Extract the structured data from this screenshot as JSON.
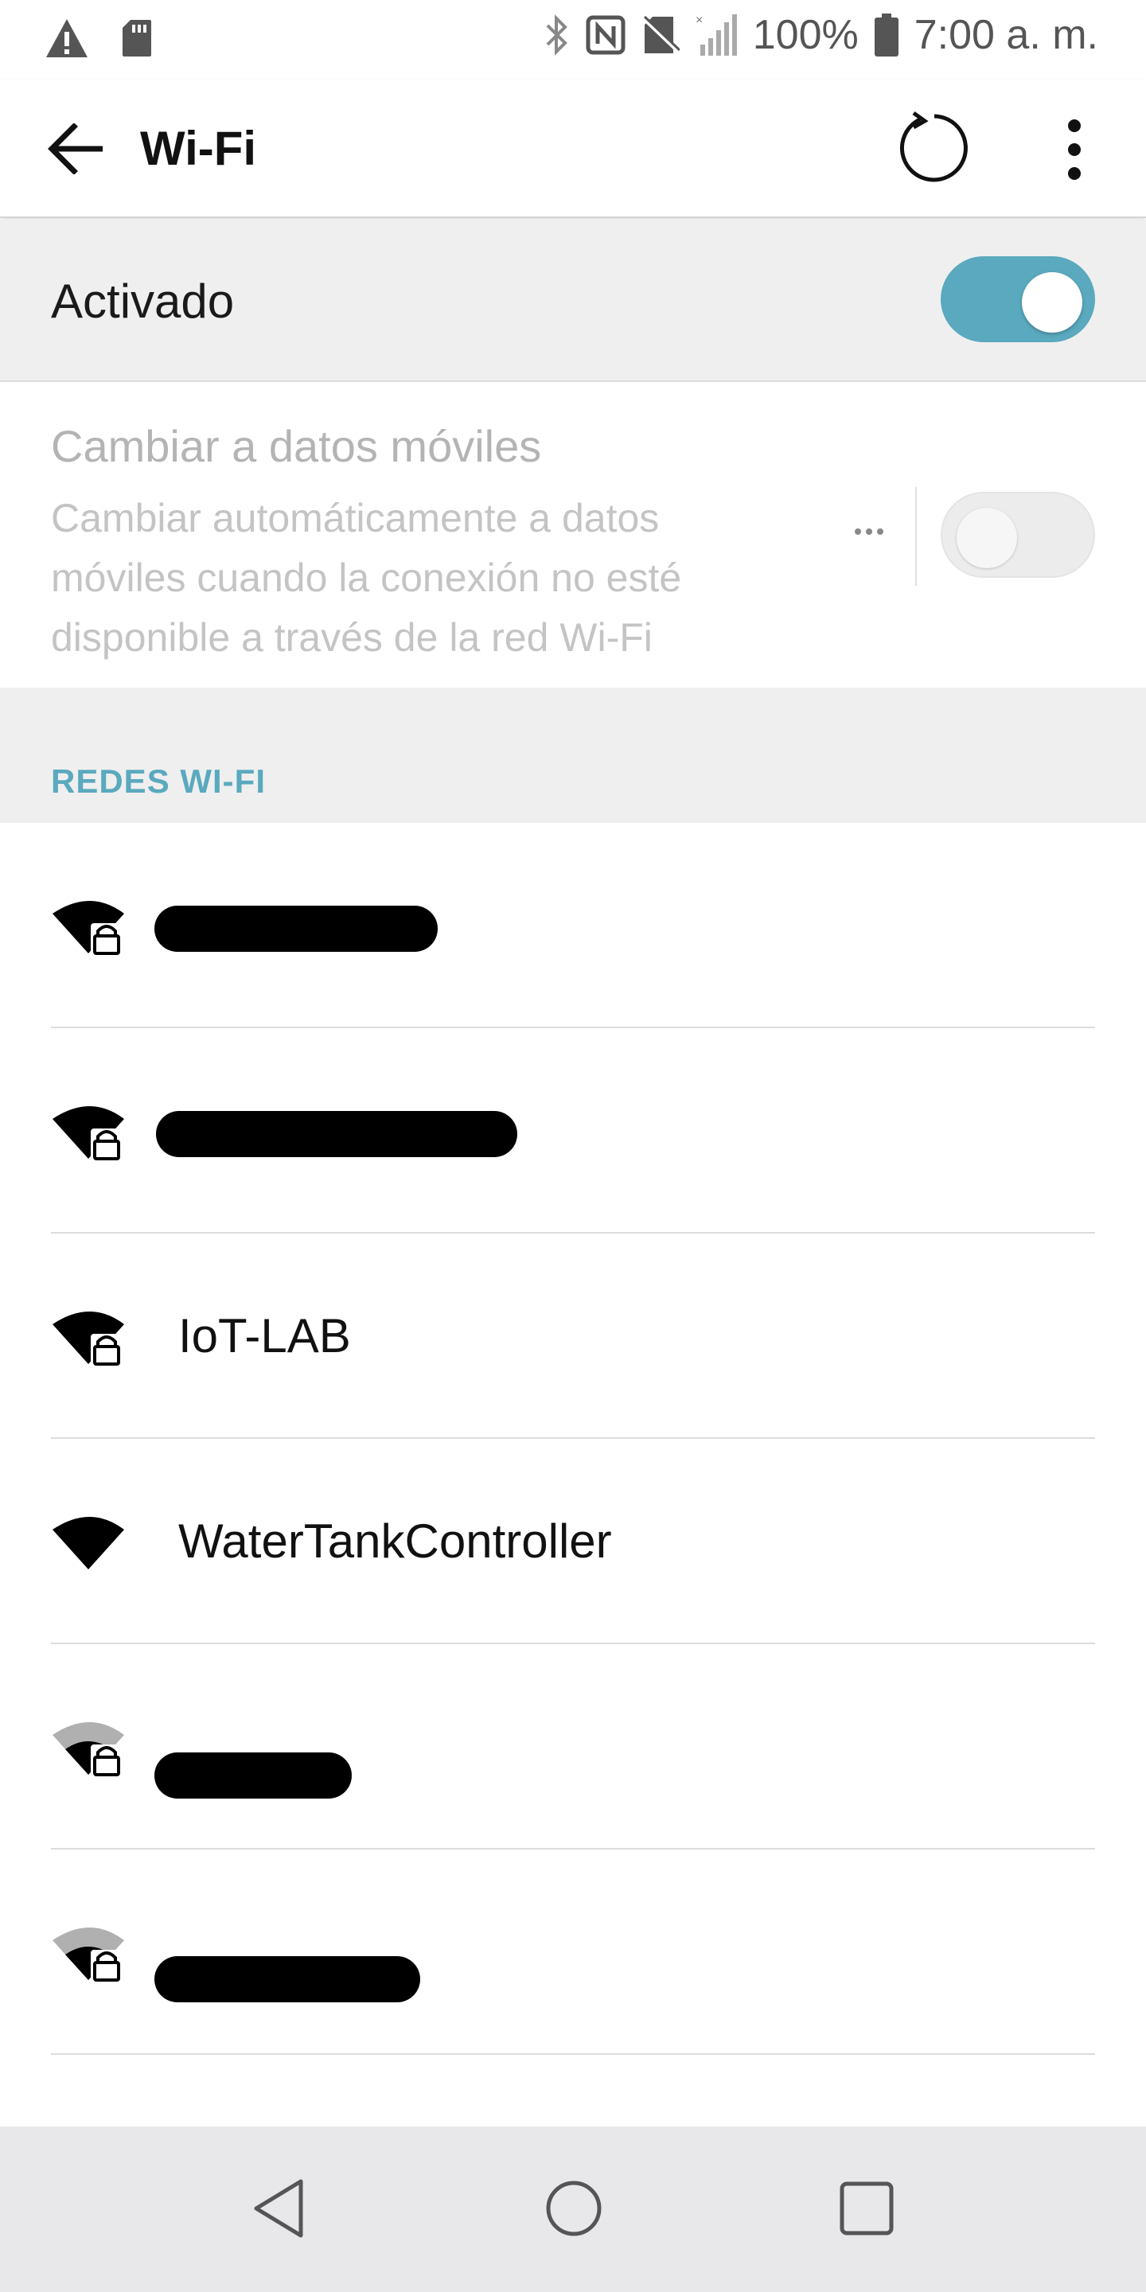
{
  "status_bar": {
    "battery_percent": "100%",
    "time": "7:00 a. m.",
    "icons": [
      "warning-icon",
      "sd-card-icon",
      "bluetooth-icon",
      "nfc-icon",
      "no-sim-icon",
      "signal-icon",
      "battery-icon"
    ]
  },
  "app_bar": {
    "title": "Wi-Fi",
    "icons": [
      "back-arrow-icon",
      "refresh-icon",
      "more-vert-icon"
    ]
  },
  "master_switch": {
    "label": "Activado",
    "on": true,
    "color": "#5aa9be"
  },
  "mobile_data": {
    "title": "Cambiar a datos móviles",
    "description": "Cambiar automáticamente a datos móviles cuando la conexión no esté disponible a través de la red Wi-Fi",
    "on": false
  },
  "section": {
    "title": "REDES WI-FI"
  },
  "networks": [
    {
      "name": "",
      "redacted": true,
      "secured": true,
      "signal": "full"
    },
    {
      "name": "",
      "redacted": true,
      "secured": true,
      "signal": "full"
    },
    {
      "name": "IoT-LAB",
      "redacted": false,
      "secured": true,
      "signal": "full"
    },
    {
      "name": "WaterTankController",
      "redacted": false,
      "secured": false,
      "signal": "full"
    },
    {
      "name": "",
      "redacted": true,
      "secured": true,
      "signal": "weak"
    },
    {
      "name": "",
      "redacted": true,
      "secured": true,
      "signal": "weak"
    }
  ],
  "nav_bar": {
    "icons": [
      "back-triangle-icon",
      "home-circle-icon",
      "recents-square-icon"
    ]
  }
}
